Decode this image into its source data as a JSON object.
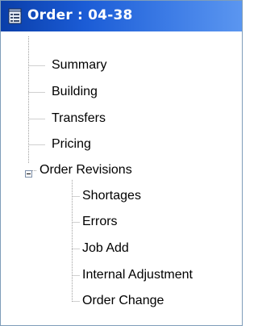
{
  "header": {
    "title": "Order : 04-38",
    "icon": "document-list-icon",
    "gradient_start": "#0a3ea9",
    "gradient_end": "#5b96f0"
  },
  "tree": {
    "items": [
      {
        "label": "Summary"
      },
      {
        "label": "Building"
      },
      {
        "label": "Transfers"
      },
      {
        "label": "Pricing"
      },
      {
        "label": "Order Revisions",
        "expanded": true,
        "expander_icon": "minus-box-icon",
        "children": [
          {
            "label": "Shortages"
          },
          {
            "label": "Errors"
          },
          {
            "label": "Job Add"
          },
          {
            "label": "Internal Adjustment"
          },
          {
            "label": "Order Change"
          }
        ]
      }
    ]
  }
}
